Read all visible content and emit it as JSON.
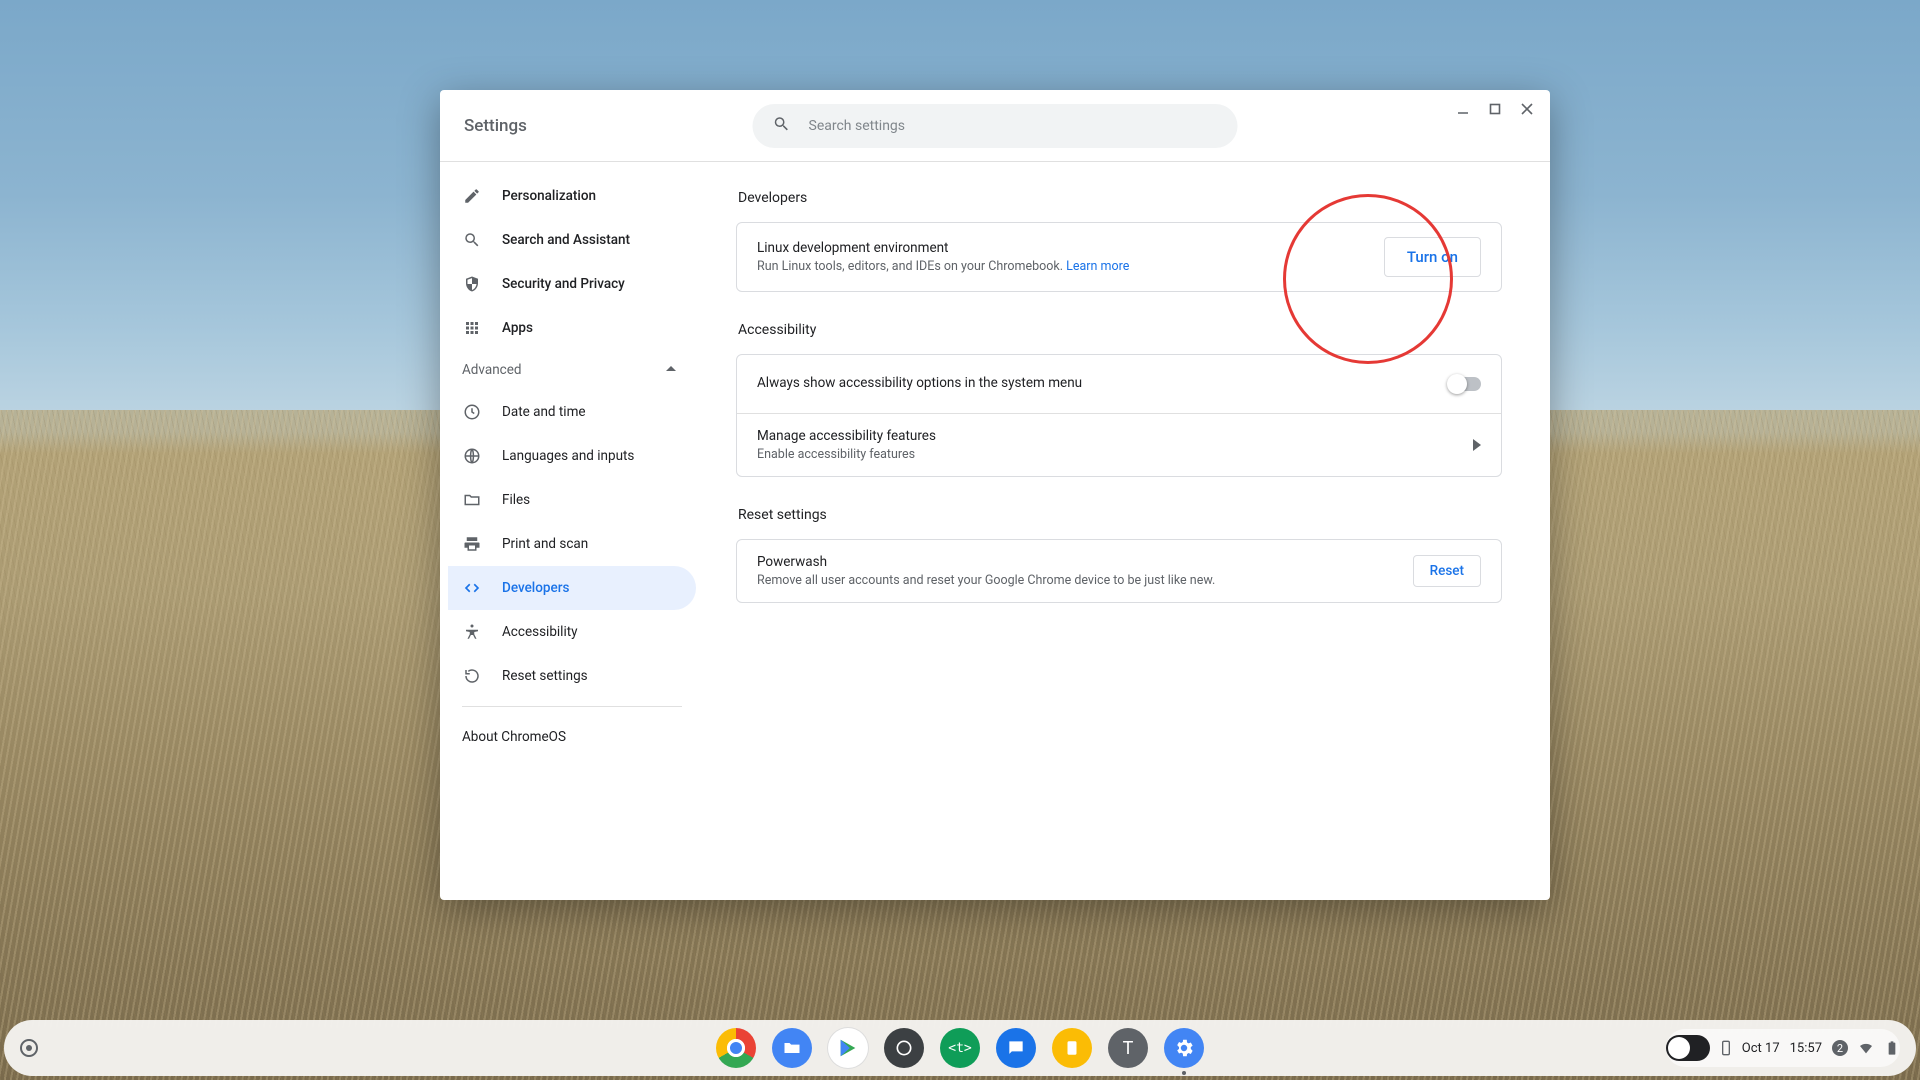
{
  "window": {
    "title": "Settings",
    "search_placeholder": "Search settings"
  },
  "sidebar": {
    "items": [
      {
        "id": "personalization",
        "label": "Personalization"
      },
      {
        "id": "search-assistant",
        "label": "Search and Assistant"
      },
      {
        "id": "security-privacy",
        "label": "Security and Privacy"
      },
      {
        "id": "apps",
        "label": "Apps"
      }
    ],
    "advanced_label": "Advanced",
    "advanced_items": [
      {
        "id": "date-time",
        "label": "Date and time"
      },
      {
        "id": "languages",
        "label": "Languages and inputs"
      },
      {
        "id": "files",
        "label": "Files"
      },
      {
        "id": "print-scan",
        "label": "Print and scan"
      },
      {
        "id": "developers",
        "label": "Developers"
      },
      {
        "id": "accessibility",
        "label": "Accessibility"
      },
      {
        "id": "reset",
        "label": "Reset settings"
      }
    ],
    "about_label": "About ChromeOS"
  },
  "sections": {
    "developers": {
      "heading": "Developers",
      "linux_title": "Linux development environment",
      "linux_sub": "Run Linux tools, editors, and IDEs on your Chromebook. ",
      "linux_learn": "Learn more",
      "turn_on": "Turn on"
    },
    "accessibility": {
      "heading": "Accessibility",
      "always_show": "Always show accessibility options in the system menu",
      "manage_title": "Manage accessibility features",
      "manage_sub": "Enable accessibility features"
    },
    "reset": {
      "heading": "Reset settings",
      "powerwash_title": "Powerwash",
      "powerwash_sub": "Remove all user accounts and reset your Google Chrome device to be just like new.",
      "reset_btn": "Reset"
    }
  },
  "shelf": {
    "date": "Oct 17",
    "time": "15:57",
    "notification_count": "2",
    "apps": [
      {
        "id": "chrome",
        "name": "Chrome"
      },
      {
        "id": "files",
        "name": "Files"
      },
      {
        "id": "play",
        "name": "Play Store"
      },
      {
        "id": "settings-quick",
        "name": "Quick Settings"
      },
      {
        "id": "vscode",
        "name": "Code"
      },
      {
        "id": "messages",
        "name": "Messages"
      },
      {
        "id": "keep",
        "name": "Keep"
      },
      {
        "id": "terminal",
        "name": "T"
      },
      {
        "id": "settings",
        "name": "Settings"
      }
    ]
  }
}
